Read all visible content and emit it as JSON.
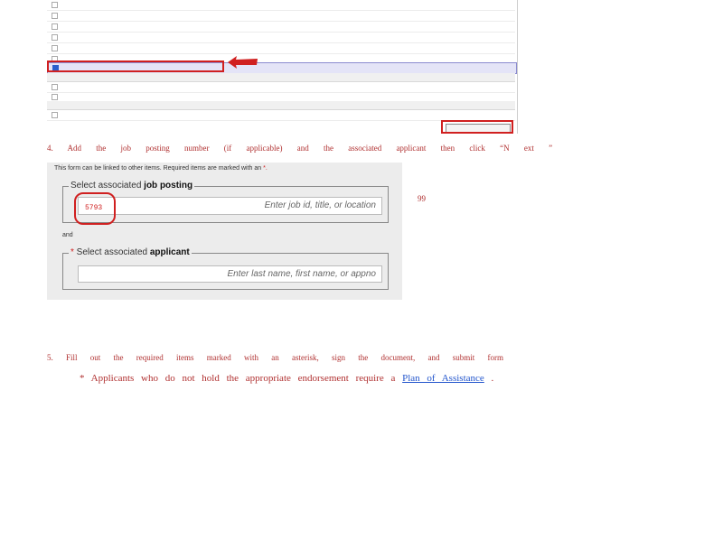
{
  "list_rows": [
    {
      "text": "",
      "date": "",
      "status": ""
    },
    {
      "text": "",
      "date": "",
      "status": ""
    },
    {
      "text": "",
      "date": "",
      "status": ""
    },
    {
      "text": "",
      "date": "",
      "status": ""
    },
    {
      "text": "",
      "date": "",
      "status": ""
    },
    {
      "text": "",
      "date": "",
      "status": ""
    },
    {
      "text": "",
      "date": "",
      "status": ""
    },
    {
      "text": "",
      "date": "",
      "status": ""
    },
    {
      "text": "",
      "date": "",
      "status": ""
    },
    {
      "text": "",
      "date": "",
      "status": ""
    }
  ],
  "step4": "4. Add the job posting number (if applicable) and the associated applicant then click “N ext ”",
  "form": {
    "intro": "This form can be linked to other items. Required items are marked with an",
    "intro_req_mark": "*.",
    "job_legend_prefix": "Select associated ",
    "job_legend_bold": "job posting",
    "job_value": "5793",
    "job_placeholder": "Enter job id, title, or location",
    "and_label": "and",
    "applicant_req_mark": "*",
    "applicant_legend_prefix": " Select associated ",
    "applicant_legend_bold": "applicant",
    "applicant_placeholder": "Enter last name, first name, or appno"
  },
  "side_number": "99",
  "step5": "5. Fill out the required items marked with an asterisk, sign the document, and submit form",
  "note_prefix": "* Applicants who do not hold the appropriate endorsement require a",
  "note_link": "Plan of Assistance",
  "note_suffix": " .",
  "colors": {
    "highlight": "#d02020",
    "instruction_text": "#b03030",
    "link": "#2255cc"
  }
}
